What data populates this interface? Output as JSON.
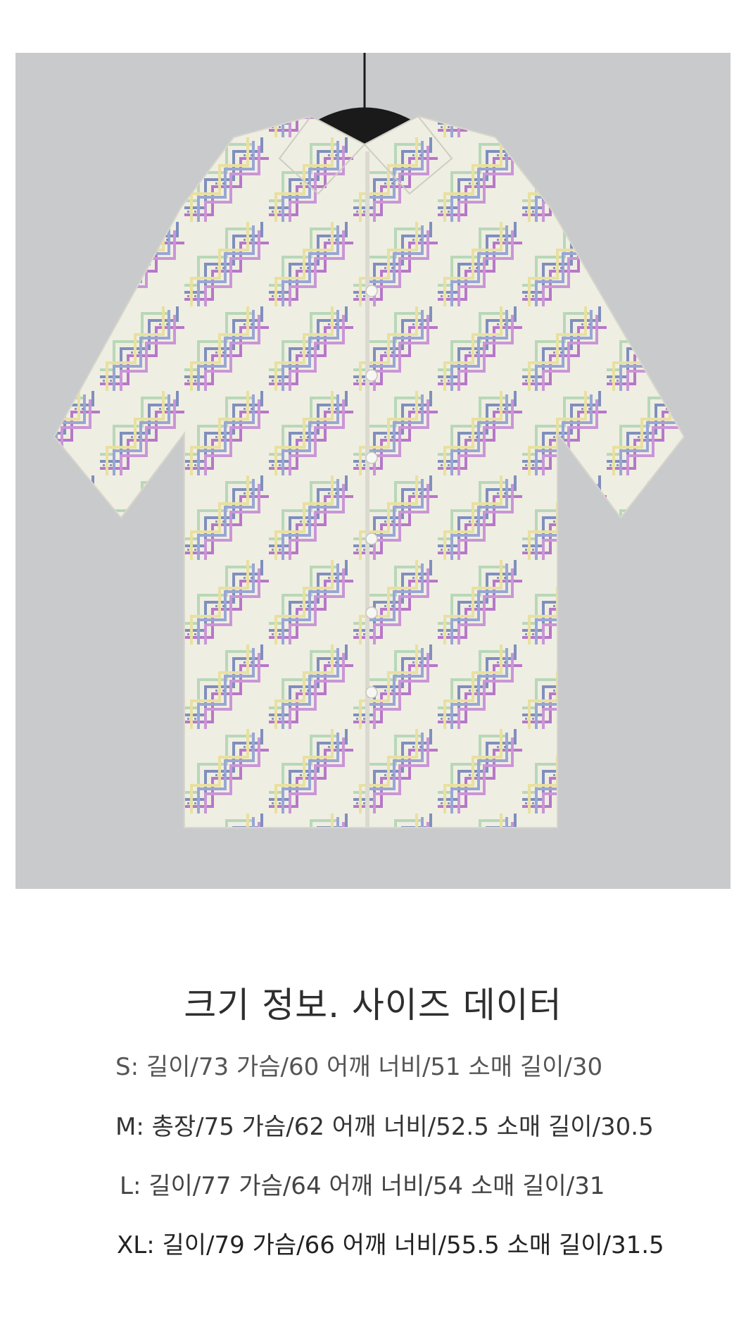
{
  "product_image": {
    "subject": "short-sleeve-shirt",
    "colors": {
      "background": "#c9cacc",
      "fabric_base": "#efeee2",
      "purple": "#b777c9",
      "blue": "#7f8fbd",
      "green": "#b8d8b8",
      "yellow": "#e8e0a0",
      "hanger": "#1a1a1a"
    }
  },
  "size_info": {
    "title": "크기 정보. 사이즈 데이터",
    "rows": [
      {
        "text": "S: 길이/73 가슴/60 어깨 너비/51 소매 길이/30"
      },
      {
        "text": "M: 총장/75 가슴/62 어깨 너비/52.5 소매 길이/30.5"
      },
      {
        "text": "L: 길이/77 가슴/64 어깨 너비/54 소매 길이/31"
      },
      {
        "text": "XL: 길이/79 가슴/66 어깨 너비/55.5 소매 길이/31.5"
      }
    ]
  }
}
